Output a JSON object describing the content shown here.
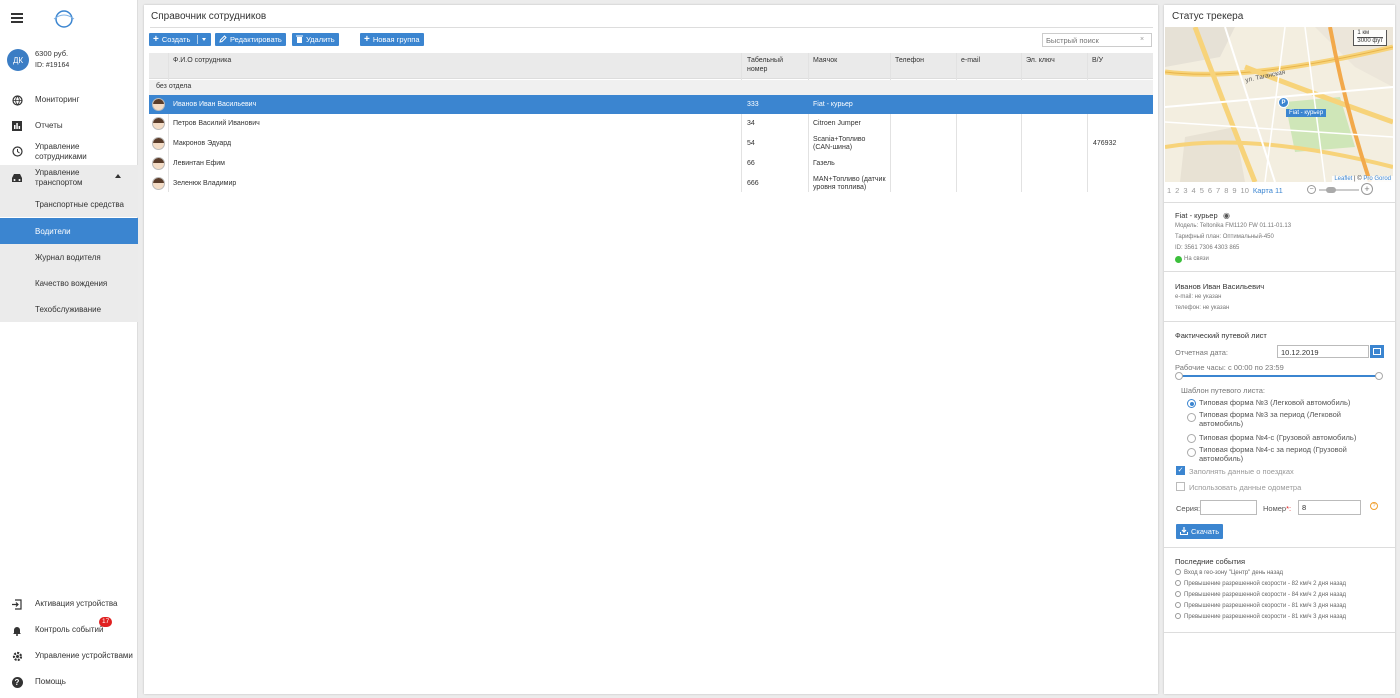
{
  "account": {
    "initials": "ДК",
    "balance": "6300 руб.",
    "id": "ID: #19164"
  },
  "nav": {
    "monitoring": "Мониторинг",
    "reports": "Отчеты",
    "employees": "Управление сотрудниками",
    "transport": "Управление транспортом",
    "sub": [
      "Транспортные средства",
      "Водители",
      "Журнал водителя",
      "Качество вождения",
      "Техобслуживание"
    ],
    "activation": "Активация устройства",
    "events": "Контроль событий",
    "events_badge": "17",
    "devices": "Управление устройствами",
    "help": "Помощь"
  },
  "main": {
    "title": "Справочник сотрудников",
    "buttons": {
      "create": "Создать",
      "edit": "Редактировать",
      "delete": "Удалить",
      "new_group": "Новая группа"
    },
    "search_placeholder": "Быстрый поиск",
    "columns": [
      "Ф.И.О сотрудника",
      "Табельный номер",
      "Маячок",
      "Телефон",
      "e-mail",
      "Эл. ключ",
      "В/У"
    ],
    "group": "без отдела",
    "rows": [
      {
        "name": "Иванов Иван Васильевич",
        "num": "333",
        "tracker": "Fiat - курьер",
        "phone": "",
        "email": "",
        "key": "",
        "license": ""
      },
      {
        "name": "Петров Василий Иванович",
        "num": "34",
        "tracker": "Citroen Jumper",
        "phone": "",
        "email": "",
        "key": "",
        "license": ""
      },
      {
        "name": "Макронов Эдуард",
        "num": "54",
        "tracker": "Scania+Топливо (CAN-шина)",
        "phone": "",
        "email": "",
        "key": "",
        "license": "476932"
      },
      {
        "name": "Левинтан Ефим",
        "num": "66",
        "tracker": "Газель",
        "phone": "",
        "email": "",
        "key": "",
        "license": ""
      },
      {
        "name": "Зеленюк Владимир",
        "num": "666",
        "tracker": "MAN+Топливо (датчик уровня топлива)",
        "phone": "",
        "email": "",
        "key": "",
        "license": ""
      }
    ]
  },
  "tracker": {
    "title": "Статус трекера",
    "map": {
      "scale_km": "1 км",
      "scale_ft": "3000 фут",
      "street": "ул. Таганская",
      "marker": "Fiat - курьер",
      "attr_link": "Leaflet",
      "attr_sep": " | © ",
      "attr_src": "Pro Gorod"
    },
    "pages": [
      "1",
      "2",
      "3",
      "4",
      "5",
      "6",
      "7",
      "8",
      "9",
      "10"
    ],
    "current_map": "Карта 11",
    "device_name": "Fiat - курьер",
    "model": "Модель: Teltonika FM1120 FW 01.11-01.13",
    "tariff": "Тарифный план: Оптимальный-450",
    "device_id": "ID: 3561 7306 4303 865",
    "status": "На связи",
    "driver_name": "Иванов Иван Васильевич",
    "driver_email": "e-mail: не указан",
    "driver_phone": "телефон: не указан",
    "waybill_title": "Фактический путевой лист",
    "report_date_label": "Отчетная дата:",
    "report_date": "10.12.2019",
    "work_hours": "Рабочие часы: с 00:00 по 23:59",
    "template_label": "Шаблон путевого листа:",
    "templates": [
      {
        "label": "Типовая форма №3 (Легковой автомобиль)",
        "selected": true
      },
      {
        "label": "Типовая форма №3 за период (Легковой автомобиль)",
        "selected": false
      },
      {
        "label": "Типовая форма №4-с (Грузовой автомобиль)",
        "selected": false
      },
      {
        "label": "Типовая форма №4-с за период (Грузовой автомобиль)",
        "selected": false
      }
    ],
    "fill_trips": "Заполнять данные о поездках",
    "use_odometer": "Использовать данные одометра",
    "series_label": "Серия:",
    "number_label": "Номер",
    "number_required": "*:",
    "number_value": "8",
    "download": "Скачать",
    "events_title": "Последние события",
    "events": [
      "Вход в гео-зону \"Центр\"    день назад",
      "Превышение разрешенной скорости - 82 км/ч    2 дня назад",
      "Превышение разрешенной скорости - 84 км/ч    2 дня назад",
      "Превышение разрешенной скорости - 81 км/ч    3 дня назад",
      "Превышение разрешенной скорости - 81 км/ч    3 дня назад"
    ]
  },
  "colors": {
    "accent": "#3b85d0",
    "online": "#3cbf3c",
    "badge": "#e02020"
  }
}
